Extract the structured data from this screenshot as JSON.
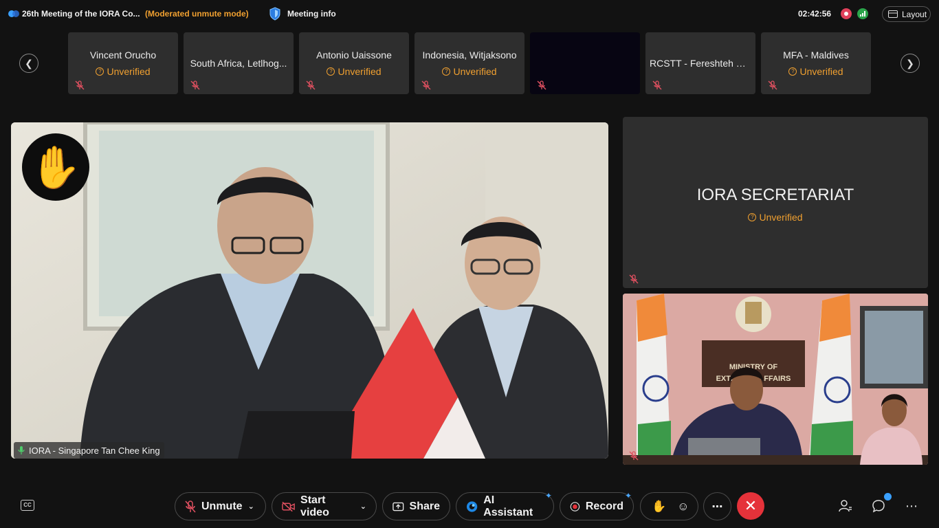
{
  "titlebar": {
    "meeting_title": "26th Meeting of the IORA Co...",
    "mode": "(Moderated unmute mode)",
    "meeting_info": "Meeting info",
    "clock": "02:42:56",
    "layout_label": "Layout"
  },
  "filmstrip": {
    "tiles": [
      {
        "name": "Vincent Orucho",
        "status": "Unverified"
      },
      {
        "name": "South Africa, Letlhog...",
        "status": ""
      },
      {
        "name": "Antonio Uaissone",
        "status": "Unverified"
      },
      {
        "name": "Indonesia, Witjaksono",
        "status": "Unverified"
      },
      {
        "name": "",
        "status": ""
      },
      {
        "name": "RCSTT - Fereshteh M...",
        "status": ""
      },
      {
        "name": "MFA - Maldives",
        "status": "Unverified"
      }
    ]
  },
  "main_video": {
    "speaker_label": "IORA - Singapore Tan Chee King"
  },
  "secretariat": {
    "name": "IORA SECRETARIAT",
    "status": "Unverified"
  },
  "india_video": {
    "sign_line1": "MINISTRY OF",
    "sign_line2": "EXTERNAL AFFAIRS"
  },
  "toolbar": {
    "unmute": "Unmute",
    "start_video": "Start video",
    "share": "Share",
    "ai_assistant": "AI Assistant",
    "record": "Record",
    "cc": "CC"
  },
  "colors": {
    "accent_orange": "#f0a030",
    "end_call": "#e5323a",
    "tile_bg": "#2e2e2e",
    "background": "#121212"
  }
}
